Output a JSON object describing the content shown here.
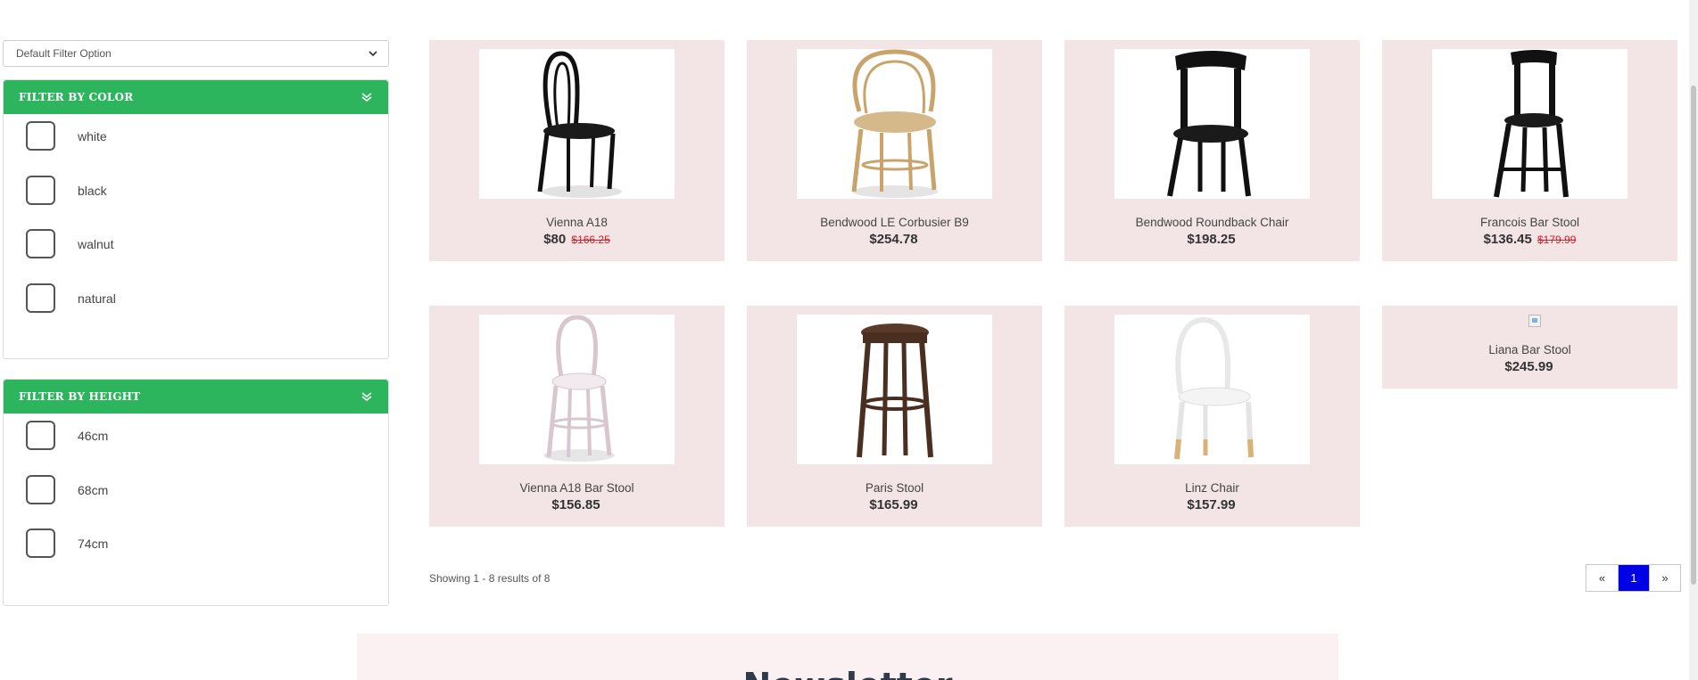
{
  "filter_select": {
    "value": "Default Filter Option"
  },
  "color_filter": {
    "title": "FILTER BY COLOR",
    "options": [
      "white",
      "black",
      "walnut",
      "natural"
    ]
  },
  "height_filter": {
    "title": "FILTER BY HEIGHT",
    "options": [
      "46cm",
      "68cm",
      "74cm"
    ]
  },
  "products": [
    {
      "name": "Vienna A18",
      "price": "$80",
      "old_price": "$166.25",
      "image": "bentwood-chair-black-icon"
    },
    {
      "name": "Bendwood LE Corbusier B9",
      "price": "$254.78",
      "old_price": "",
      "image": "armchair-natural-icon"
    },
    {
      "name": "Bendwood Roundback Chair",
      "price": "$198.25",
      "old_price": "",
      "image": "roundback-chair-black-icon"
    },
    {
      "name": "Francois Bar Stool",
      "price": "$136.45",
      "old_price": "$179.99",
      "image": "bar-stool-black-icon"
    },
    {
      "name": "Vienna A18 Bar Stool",
      "price": "$156.85",
      "old_price": "",
      "image": "bar-stool-white-icon"
    },
    {
      "name": "Paris Stool",
      "price": "$165.99",
      "old_price": "",
      "image": "stool-walnut-icon"
    },
    {
      "name": "Linz Chair",
      "price": "$157.99",
      "old_price": "",
      "image": "chair-white-icon"
    },
    {
      "name": "Liana Bar Stool",
      "price": "$245.99",
      "old_price": "",
      "image": "broken-image-icon"
    }
  ],
  "results_text": "Showing 1 - 8 results of 8",
  "pagination": {
    "prev": "«",
    "current": "1",
    "next": "»"
  },
  "newsletter": {
    "title": "Newsletter"
  },
  "colors": {
    "accent_green": "#2db55d",
    "card_bg": "#f3e5e6",
    "sale_red": "#d0202a",
    "page_active": "#0000e6"
  }
}
